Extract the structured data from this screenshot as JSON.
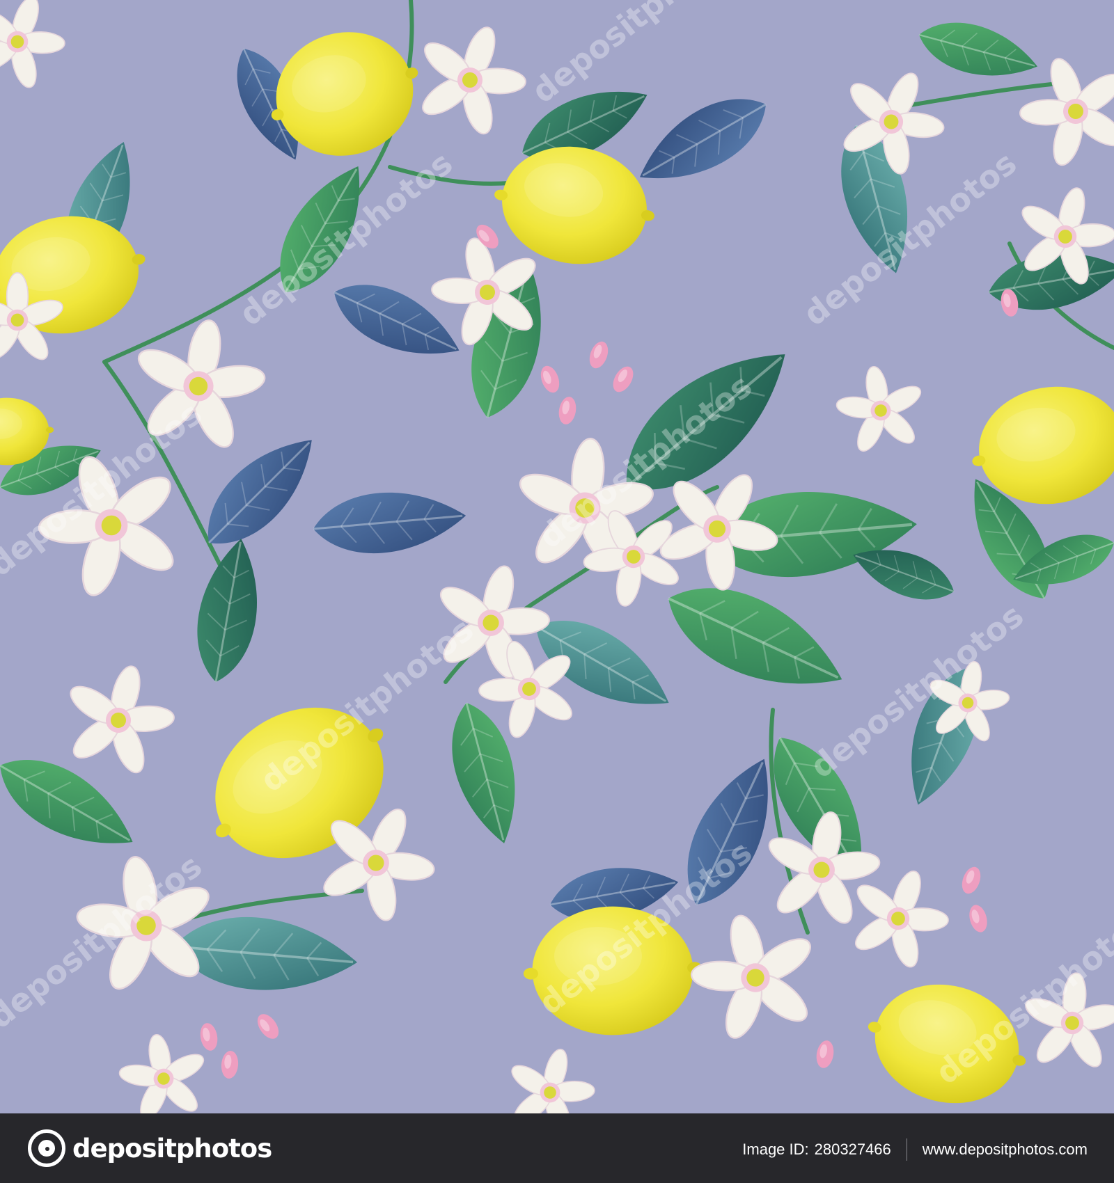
{
  "background_color": "#a3a6c9",
  "watermark": {
    "text": "depositphotos"
  },
  "footer": {
    "brand": "depositphotos",
    "image_id_label": "Image ID:",
    "image_id": "280327466",
    "site_url": "www.depositphotos.com"
  },
  "colors": {
    "lemon": "#f2ea3a",
    "lemon_shade": "#d9cf1f",
    "leaf_green": "#3b9a5a",
    "leaf_dark": "#2d6f63",
    "leaf_blue": "#3f5f8f",
    "petal": "#f4f1ea",
    "petal_pink": "#eab8cf",
    "bud": "#ee9ec0",
    "footer_bg": "#27272b"
  }
}
